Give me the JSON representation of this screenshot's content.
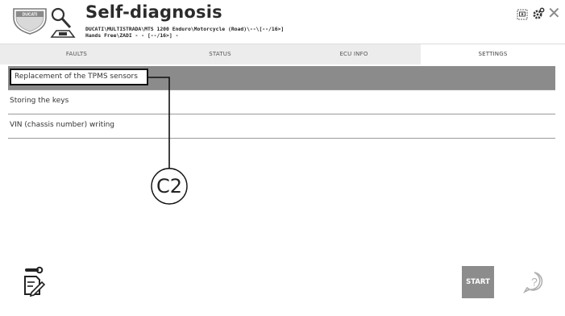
{
  "header": {
    "title": "Self-diagnosis",
    "vehicle_path": "DUCATI\\MULTISTRADA\\MTS 1200 Enduro\\Motorcycle (Road)\\--\\[--/16>]",
    "ecu_path": "Hands Free\\ZADI - - [--/16>] -",
    "logo_text": "DUCATI"
  },
  "tabs": [
    {
      "label": "FAULTS"
    },
    {
      "label": "STATUS"
    },
    {
      "label": "ECU INFO"
    },
    {
      "label": "SETTINGS"
    }
  ],
  "active_tab": "SETTINGS",
  "list": {
    "items": [
      {
        "label": "Replacement of the TPMS sensors"
      },
      {
        "label": "Storing the keys"
      },
      {
        "label": "VIN (chassis number) writing"
      }
    ]
  },
  "callout": {
    "label": "C2"
  },
  "footer": {
    "start_label": "START"
  },
  "icons": {
    "close": "close-icon",
    "gear": "gear-icon",
    "screen": "screen-icon",
    "help": "help-icon",
    "tool": "tool-icon"
  },
  "colors": {
    "selected_row": "#8b8b8b",
    "start_button": "#8c8c8c",
    "tab_bar": "#ececec"
  }
}
